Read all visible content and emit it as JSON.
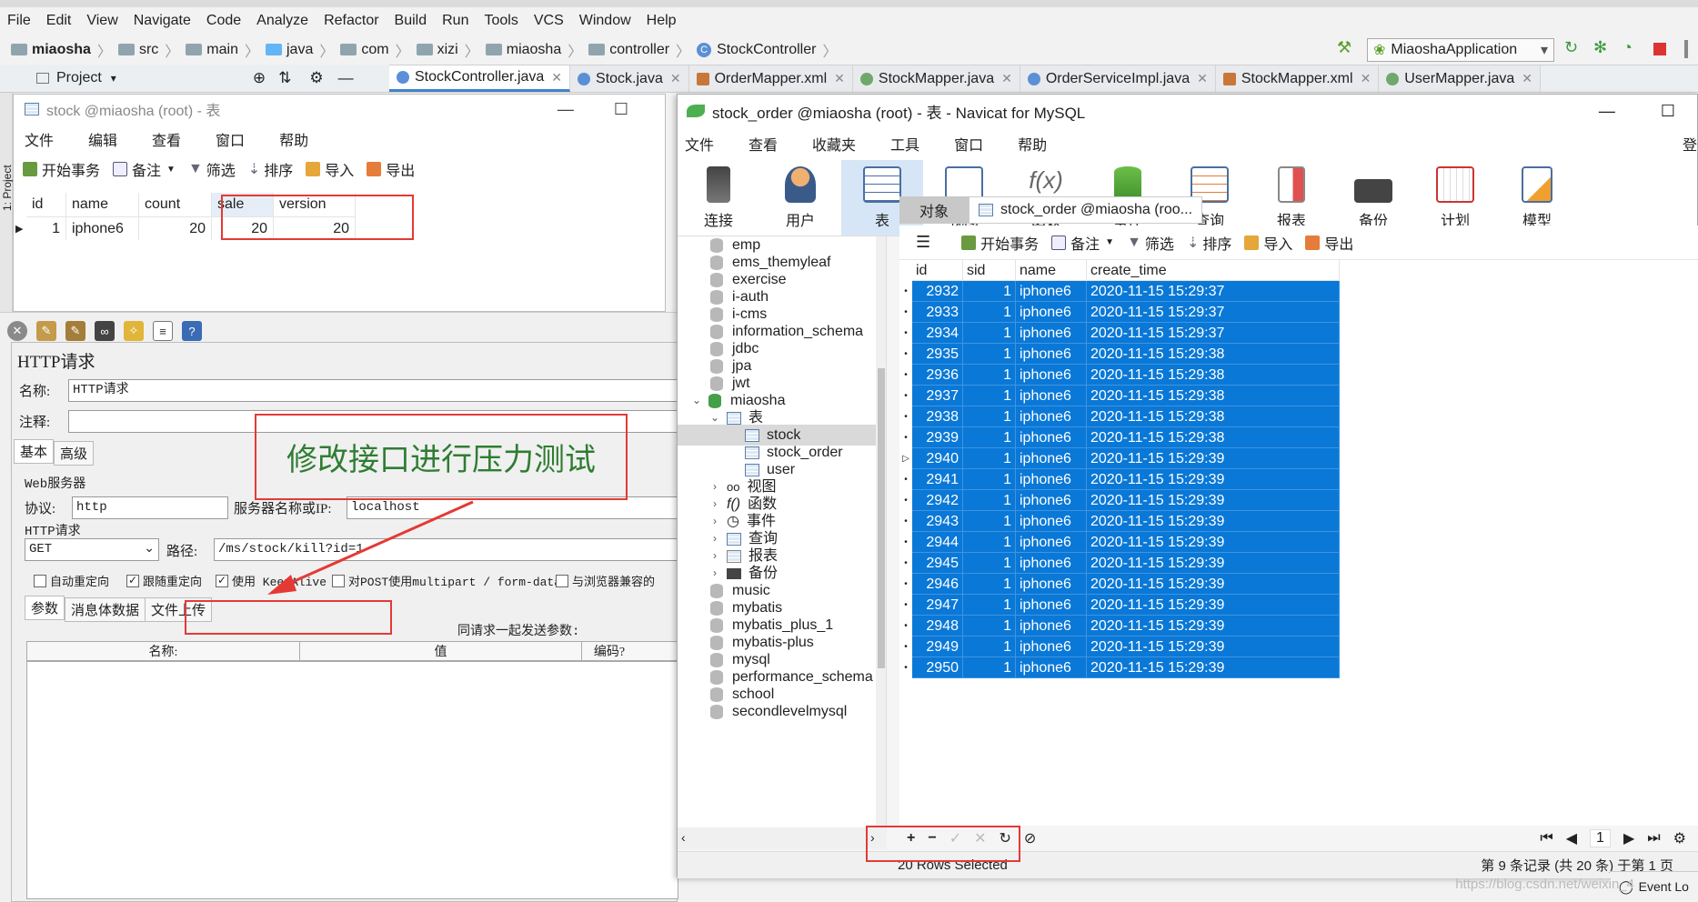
{
  "ide": {
    "menu": [
      "File",
      "Edit",
      "View",
      "Navigate",
      "Code",
      "Analyze",
      "Refactor",
      "Build",
      "Run",
      "Tools",
      "VCS",
      "Window",
      "Help"
    ],
    "breadcrumb": [
      "miaosha",
      "src",
      "main",
      "java",
      "com",
      "xizi",
      "miaosha",
      "controller",
      "StockController"
    ],
    "run_config": "MiaoshaApplication",
    "project_tab": "Project",
    "left_strip_label": "1: Project",
    "tabs": [
      "StockController.java",
      "Stock.java",
      "OrderMapper.xml",
      "StockMapper.java",
      "OrderServiceImpl.java",
      "StockMapper.xml",
      "UserMapper.java"
    ],
    "event_log": "Event Lo"
  },
  "stock_window": {
    "title": "stock @miaosha (root) - 表",
    "menu": [
      "文件",
      "编辑",
      "查看",
      "窗口",
      "帮助"
    ],
    "toolbar": [
      "开始事务",
      "备注",
      "筛选",
      "排序",
      "导入",
      "导出"
    ],
    "columns": [
      "id",
      "name",
      "count",
      "sale",
      "version"
    ],
    "row": [
      "1",
      "iphone6",
      "20",
      "20",
      "20"
    ]
  },
  "jmeter": {
    "title": "HTTP请求",
    "name_label": "名称:",
    "name_value": "HTTP请求",
    "comment_label": "注释:",
    "tab_basic": "基本",
    "tab_advanced": "高级",
    "web_server_label": "Web服务器",
    "protocol_label": "协议:",
    "protocol_value": "http",
    "server_label": "服务器名称或IP:",
    "server_value": "localhost",
    "http_request_label": "HTTP请求",
    "method_value": "GET",
    "path_label": "路径:",
    "path_value": "/ms/stock/kill?id=1",
    "checks": [
      "自动重定向",
      "跟随重定向",
      "使用 KeepAlive",
      "对POST使用multipart / form-data",
      "与浏览器兼容的"
    ],
    "check_states": [
      false,
      true,
      true,
      false,
      false
    ],
    "param_tabs": [
      "参数",
      "消息体数据",
      "文件上传"
    ],
    "send_params": "同请求一起发送参数:",
    "param_cols": [
      "名称:",
      "值",
      "编码?"
    ]
  },
  "annotation": "修改接口进行压力测试",
  "navicat": {
    "title": "stock_order @miaosha (root) - 表 - Navicat for MySQL",
    "menu": [
      "文件",
      "查看",
      "收藏夹",
      "工具",
      "窗口",
      "帮助"
    ],
    "menu_right": "登",
    "ribbon": [
      "连接",
      "用户",
      "表",
      "视图",
      "函数",
      "事件",
      "查询",
      "报表",
      "备份",
      "计划",
      "模型"
    ],
    "tree": {
      "databases_top": [
        "emp",
        "ems_themyleaf",
        "exercise",
        "i-auth",
        "i-cms",
        "information_schema",
        "jdbc",
        "jpa",
        "jwt"
      ],
      "open_db": "miaosha",
      "tables_folder": "表",
      "tables": [
        "stock",
        "stock_order",
        "user"
      ],
      "folders": [
        "视图",
        "函数",
        "事件",
        "查询",
        "报表",
        "备份"
      ],
      "databases_bottom": [
        "music",
        "mybatis",
        "mybatis_plus_1",
        "mybatis-plus",
        "mysql",
        "performance_schema",
        "school",
        "secondlevelmysql"
      ]
    },
    "tab_objects": "对象",
    "tab_data": "stock_order @miaosha (roo...",
    "toolbar": [
      "开始事务",
      "备注",
      "筛选",
      "排序",
      "导入",
      "导出"
    ],
    "columns": [
      "id",
      "sid",
      "name",
      "create_time"
    ],
    "rows": [
      [
        "2932",
        "1",
        "iphone6",
        "2020-11-15 15:29:37"
      ],
      [
        "2933",
        "1",
        "iphone6",
        "2020-11-15 15:29:37"
      ],
      [
        "2934",
        "1",
        "iphone6",
        "2020-11-15 15:29:37"
      ],
      [
        "2935",
        "1",
        "iphone6",
        "2020-11-15 15:29:38"
      ],
      [
        "2936",
        "1",
        "iphone6",
        "2020-11-15 15:29:38"
      ],
      [
        "2937",
        "1",
        "iphone6",
        "2020-11-15 15:29:38"
      ],
      [
        "2938",
        "1",
        "iphone6",
        "2020-11-15 15:29:38"
      ],
      [
        "2939",
        "1",
        "iphone6",
        "2020-11-15 15:29:38"
      ],
      [
        "2940",
        "1",
        "iphone6",
        "2020-11-15 15:29:39"
      ],
      [
        "2941",
        "1",
        "iphone6",
        "2020-11-15 15:29:39"
      ],
      [
        "2942",
        "1",
        "iphone6",
        "2020-11-15 15:29:39"
      ],
      [
        "2943",
        "1",
        "iphone6",
        "2020-11-15 15:29:39"
      ],
      [
        "2944",
        "1",
        "iphone6",
        "2020-11-15 15:29:39"
      ],
      [
        "2945",
        "1",
        "iphone6",
        "2020-11-15 15:29:39"
      ],
      [
        "2946",
        "1",
        "iphone6",
        "2020-11-15 15:29:39"
      ],
      [
        "2947",
        "1",
        "iphone6",
        "2020-11-15 15:29:39"
      ],
      [
        "2948",
        "1",
        "iphone6",
        "2020-11-15 15:29:39"
      ],
      [
        "2949",
        "1",
        "iphone6",
        "2020-11-15 15:29:39"
      ],
      [
        "2950",
        "1",
        "iphone6",
        "2020-11-15 15:29:39"
      ]
    ],
    "page_number": "1",
    "rows_selected": "20 Rows Selected",
    "record_info": "第 9 条记录 (共 20 条) 于第 1 页"
  },
  "watermark": "https://blog.csdn.net/weixin_4",
  "colors": {
    "selection": "#0a78d7",
    "annotation_red": "#e53935",
    "annotation_green": "#2e7d32"
  }
}
